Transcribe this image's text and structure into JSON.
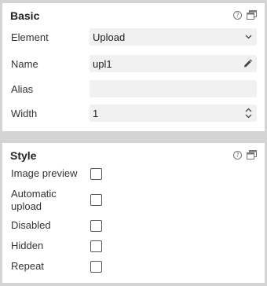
{
  "basic": {
    "title": "Basic",
    "help_glyph": "?",
    "fields": {
      "element": {
        "label": "Element",
        "value": "Upload",
        "icon": "chevron-down-icon"
      },
      "name": {
        "label": "Name",
        "value": "upl1",
        "icon": "pencil-icon"
      },
      "alias": {
        "label": "Alias",
        "value": ""
      },
      "width": {
        "label": "Width",
        "value": "1",
        "icon": "stepper-icon"
      }
    }
  },
  "style": {
    "title": "Style",
    "help_glyph": "?",
    "options": {
      "image_preview": {
        "label": "Image preview",
        "checked": false
      },
      "automatic_upload": {
        "label_line1": "Automatic",
        "label_line2": "upload",
        "checked": false
      },
      "disabled": {
        "label": "Disabled",
        "checked": false
      },
      "hidden": {
        "label": "Hidden",
        "checked": false
      },
      "repeat": {
        "label": "Repeat",
        "checked": false
      }
    }
  }
}
